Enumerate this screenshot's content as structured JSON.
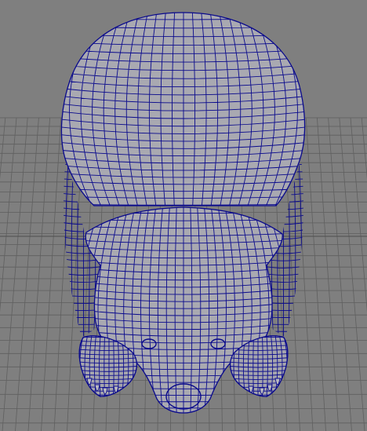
{
  "viewport": {
    "background_color": "#7f7f7f",
    "grid_color": "#5f5f5f",
    "model_fill_color": "#a9a9b1",
    "wireframe_color": "#0a0a8c",
    "object": "creature-model-wireframe-top-view"
  }
}
